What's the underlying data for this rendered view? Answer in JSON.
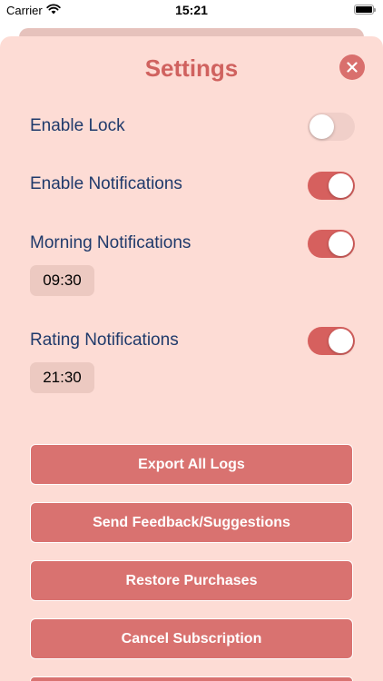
{
  "status_bar": {
    "carrier": "Carrier",
    "time": "15:21"
  },
  "header": {
    "title": "Settings"
  },
  "settings": {
    "enable_lock": {
      "label": "Enable Lock",
      "on": false
    },
    "enable_notifications": {
      "label": "Enable Notifications",
      "on": true
    },
    "morning_notifications": {
      "label": "Morning Notifications",
      "on": true,
      "time": "09:30"
    },
    "rating_notifications": {
      "label": "Rating Notifications",
      "on": true,
      "time": "21:30"
    }
  },
  "actions": {
    "export_logs": "Export All Logs",
    "send_feedback": "Send Feedback/Suggestions",
    "restore_purchases": "Restore Purchases",
    "cancel_subscription": "Cancel Subscription"
  },
  "colors": {
    "sheet_background": "#fddcd5",
    "accent": "#d6605e",
    "button": "#d97270",
    "label_text": "#1f3a6b",
    "title": "#d0625f"
  },
  "icons": {
    "close": "close-icon",
    "wifi": "wifi-icon",
    "battery": "battery-icon"
  }
}
